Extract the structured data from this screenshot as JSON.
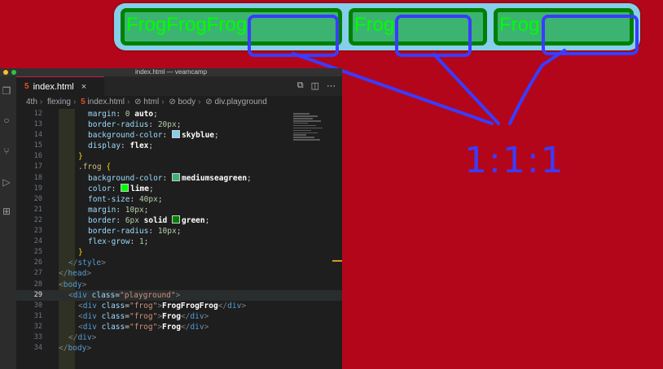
{
  "playground": {
    "frogs": [
      {
        "label": "FrogFrogFrog"
      },
      {
        "label": "Frog"
      },
      {
        "label": "Frog"
      }
    ]
  },
  "annotation": {
    "ratio": "1:1:1",
    "color": "#3a3cff"
  },
  "editor": {
    "window_title": "index.html — veamcamp",
    "tab": {
      "label": "index.html",
      "close": "×"
    },
    "breadcrumb": [
      "4th",
      "flexing",
      "index.html",
      "html",
      "body",
      "div.playground"
    ],
    "cursor_line": 29,
    "lines": [
      {
        "n": "12",
        "parts": [
          [
            "k-prop",
            "margin"
          ],
          [
            "k-plain",
            ": "
          ],
          [
            "k-num",
            "0"
          ],
          [
            "k-bold",
            " auto"
          ],
          [
            "k-plain",
            ";"
          ]
        ],
        "indent": 4
      },
      {
        "n": "13",
        "parts": [
          [
            "k-prop",
            "border-radius"
          ],
          [
            "k-plain",
            ": "
          ],
          [
            "k-num",
            "20px"
          ],
          [
            "k-plain",
            ";"
          ]
        ],
        "indent": 4
      },
      {
        "n": "14",
        "parts": [
          [
            "k-prop",
            "background-color"
          ],
          [
            "k-plain",
            ": "
          ],
          [
            "sw",
            "#87ceeb"
          ],
          [
            "k-bold",
            "skyblue"
          ],
          [
            "k-plain",
            ";"
          ]
        ],
        "indent": 4
      },
      {
        "n": "15",
        "parts": [
          [
            "k-prop",
            "display"
          ],
          [
            "k-plain",
            ": "
          ],
          [
            "k-bold",
            "flex"
          ],
          [
            "k-plain",
            ";"
          ]
        ],
        "indent": 4
      },
      {
        "n": "16",
        "parts": [
          [
            "k-brace",
            "}"
          ]
        ],
        "indent": 3
      },
      {
        "n": "17",
        "parts": [
          [
            "k-sel",
            ".frog"
          ],
          [
            "k-plain",
            " "
          ],
          [
            "k-brace",
            "{"
          ]
        ],
        "indent": 3
      },
      {
        "n": "18",
        "parts": [
          [
            "k-prop",
            "background-color"
          ],
          [
            "k-plain",
            ": "
          ],
          [
            "sw",
            "#3cb371"
          ],
          [
            "k-bold",
            "mediumseagreen"
          ],
          [
            "k-plain",
            ";"
          ]
        ],
        "indent": 4
      },
      {
        "n": "19",
        "parts": [
          [
            "k-prop",
            "color"
          ],
          [
            "k-plain",
            ": "
          ],
          [
            "sw",
            "#00ff00"
          ],
          [
            "k-bold",
            "lime"
          ],
          [
            "k-plain",
            ";"
          ]
        ],
        "indent": 4
      },
      {
        "n": "20",
        "parts": [
          [
            "k-prop",
            "font-size"
          ],
          [
            "k-plain",
            ": "
          ],
          [
            "k-num",
            "40px"
          ],
          [
            "k-plain",
            ";"
          ]
        ],
        "indent": 4
      },
      {
        "n": "21",
        "parts": [
          [
            "k-prop",
            "margin"
          ],
          [
            "k-plain",
            ": "
          ],
          [
            "k-num",
            "10px"
          ],
          [
            "k-plain",
            ";"
          ]
        ],
        "indent": 4
      },
      {
        "n": "22",
        "parts": [
          [
            "k-prop",
            "border"
          ],
          [
            "k-plain",
            ": "
          ],
          [
            "k-num",
            "6px"
          ],
          [
            "k-bold",
            " solid "
          ],
          [
            "sw",
            "#008000"
          ],
          [
            "k-bold",
            "green"
          ],
          [
            "k-plain",
            ";"
          ]
        ],
        "indent": 4
      },
      {
        "n": "23",
        "parts": [
          [
            "k-prop",
            "border-radius"
          ],
          [
            "k-plain",
            ": "
          ],
          [
            "k-num",
            "10px"
          ],
          [
            "k-plain",
            ";"
          ]
        ],
        "indent": 4
      },
      {
        "n": "24",
        "parts": [
          [
            "k-prop",
            "flex-grow"
          ],
          [
            "k-plain",
            ": "
          ],
          [
            "k-num",
            "1"
          ],
          [
            "k-plain",
            ";"
          ]
        ],
        "indent": 4
      },
      {
        "n": "25",
        "parts": [
          [
            "k-brace",
            "}"
          ]
        ],
        "indent": 3
      },
      {
        "n": "26",
        "parts": [
          [
            "k-punc",
            "</"
          ],
          [
            "k-tag",
            "style"
          ],
          [
            "k-punc",
            ">"
          ]
        ],
        "indent": 2
      },
      {
        "n": "27",
        "parts": [
          [
            "k-punc",
            "</"
          ],
          [
            "k-tag",
            "head"
          ],
          [
            "k-punc",
            ">"
          ]
        ],
        "indent": 1
      },
      {
        "n": "28",
        "parts": [
          [
            "k-punc",
            "<"
          ],
          [
            "k-tag",
            "body"
          ],
          [
            "k-punc",
            ">"
          ]
        ],
        "indent": 1
      },
      {
        "n": "29",
        "parts": [
          [
            "k-punc",
            "<"
          ],
          [
            "k-tag",
            "div"
          ],
          [
            "k-plain",
            " "
          ],
          [
            "k-attr",
            "class"
          ],
          [
            "k-plain",
            "="
          ],
          [
            "k-str",
            "\"playground\""
          ],
          [
            "k-punc",
            ">"
          ]
        ],
        "indent": 2
      },
      {
        "n": "30",
        "parts": [
          [
            "k-punc",
            "<"
          ],
          [
            "k-tag",
            "div"
          ],
          [
            "k-plain",
            " "
          ],
          [
            "k-attr",
            "class"
          ],
          [
            "k-plain",
            "="
          ],
          [
            "k-str",
            "\"frog\""
          ],
          [
            "k-punc",
            ">"
          ],
          [
            "k-bold",
            "FrogFrogFrog"
          ],
          [
            "k-punc",
            "</"
          ],
          [
            "k-tag",
            "div"
          ],
          [
            "k-punc",
            ">"
          ]
        ],
        "indent": 3
      },
      {
        "n": "31",
        "parts": [
          [
            "k-punc",
            "<"
          ],
          [
            "k-tag",
            "div"
          ],
          [
            "k-plain",
            " "
          ],
          [
            "k-attr",
            "class"
          ],
          [
            "k-plain",
            "="
          ],
          [
            "k-str",
            "\"frog\""
          ],
          [
            "k-punc",
            ">"
          ],
          [
            "k-bold",
            "Frog"
          ],
          [
            "k-punc",
            "</"
          ],
          [
            "k-tag",
            "div"
          ],
          [
            "k-punc",
            ">"
          ]
        ],
        "indent": 3
      },
      {
        "n": "32",
        "parts": [
          [
            "k-punc",
            "<"
          ],
          [
            "k-tag",
            "div"
          ],
          [
            "k-plain",
            " "
          ],
          [
            "k-attr",
            "class"
          ],
          [
            "k-plain",
            "="
          ],
          [
            "k-str",
            "\"frog\""
          ],
          [
            "k-punc",
            ">"
          ],
          [
            "k-bold",
            "Frog"
          ],
          [
            "k-punc",
            "</"
          ],
          [
            "k-tag",
            "div"
          ],
          [
            "k-punc",
            ">"
          ]
        ],
        "indent": 3
      },
      {
        "n": "33",
        "parts": [
          [
            "k-punc",
            "</"
          ],
          [
            "k-tag",
            "div"
          ],
          [
            "k-punc",
            ">"
          ]
        ],
        "indent": 2
      },
      {
        "n": "34",
        "parts": [
          [
            "k-punc",
            "</"
          ],
          [
            "k-tag",
            "body"
          ],
          [
            "k-punc",
            ">"
          ]
        ],
        "indent": 1
      }
    ]
  }
}
